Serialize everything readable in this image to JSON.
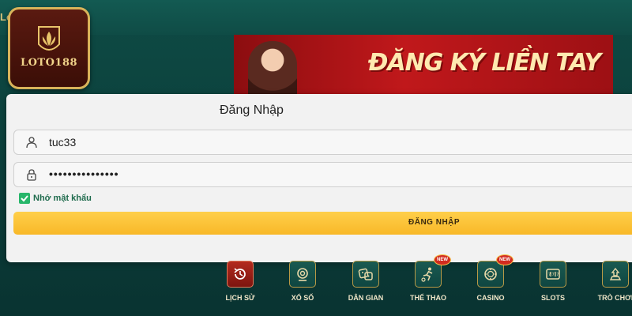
{
  "header": {
    "fragment": "Lo"
  },
  "logo": {
    "text": "LOTO188"
  },
  "banner": {
    "headline": "ĐĂNG KÝ LIỀN TAY"
  },
  "login": {
    "title": "Đăng Nhập",
    "username_value": "tuc33",
    "password_value": "•••••••••••••••",
    "remember_label": "Nhớ mật khẩu",
    "remember_checked": true,
    "submit_label": "ĐĂNG NHẬP"
  },
  "nav": {
    "items": [
      {
        "label": "LỊCH SỬ",
        "icon": "history-icon",
        "active": true
      },
      {
        "label": "XỔ SỐ",
        "icon": "lottery-icon"
      },
      {
        "label": "DÂN GIAN",
        "icon": "dice-icon"
      },
      {
        "label": "THỂ THAO",
        "icon": "sports-icon",
        "badge": "NEW"
      },
      {
        "label": "CASINO",
        "icon": "casino-chip-icon",
        "badge": "NEW"
      },
      {
        "label": "SLOTS",
        "icon": "slot-machine-icon"
      },
      {
        "label": "TRÒ CHƠI",
        "icon": "games-icon"
      }
    ]
  },
  "colors": {
    "background": "#0e4b45",
    "accent_gold": "#d8b35a",
    "button_yellow": "#f8b828",
    "check_green": "#27b66a"
  }
}
